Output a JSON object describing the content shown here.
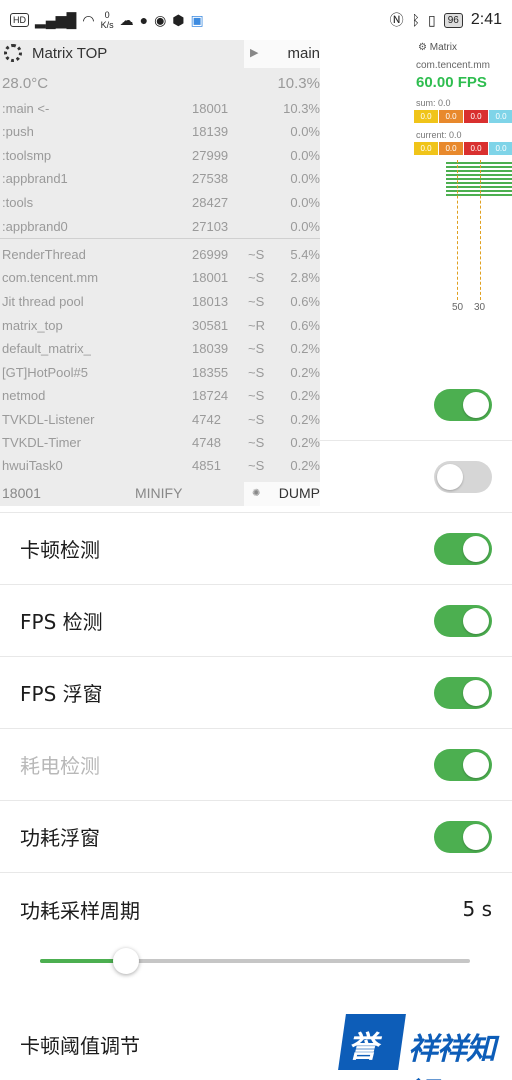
{
  "status_bar": {
    "left_badges": [
      "HD",
      "46",
      "5G"
    ],
    "net_speed_value": "0",
    "net_speed_unit": "K/s",
    "battery": "96",
    "time": "2:41"
  },
  "matrix_panel": {
    "title": "Matrix TOP",
    "tab_label": "main",
    "temperature": "28.0°C",
    "total_cpu": "10.3%",
    "processes": [
      {
        "name": ":main <-",
        "pid": "18001",
        "cpu": "10.3%"
      },
      {
        "name": ":push",
        "pid": "18139",
        "cpu": "0.0%"
      },
      {
        "name": ":toolsmp",
        "pid": "27999",
        "cpu": "0.0%"
      },
      {
        "name": ":appbrand1",
        "pid": "27538",
        "cpu": "0.0%"
      },
      {
        "name": ":tools",
        "pid": "28427",
        "cpu": "0.0%"
      },
      {
        "name": ":appbrand0",
        "pid": "27103",
        "cpu": "0.0%"
      }
    ],
    "threads": [
      {
        "name": "RenderThread",
        "tid": "26999",
        "state": "~S",
        "cpu": "5.4%"
      },
      {
        "name": "com.tencent.mm",
        "tid": "18001",
        "state": "~S",
        "cpu": "2.8%"
      },
      {
        "name": "Jit thread pool",
        "tid": "18013",
        "state": "~S",
        "cpu": "0.6%"
      },
      {
        "name": "matrix_top",
        "tid": "30581",
        "state": "~R",
        "cpu": "0.6%"
      },
      {
        "name": "default_matrix_",
        "tid": "18039",
        "state": "~S",
        "cpu": "0.2%"
      },
      {
        "name": "[GT]HotPool#5",
        "tid": "18355",
        "state": "~S",
        "cpu": "0.2%"
      },
      {
        "name": "netmod",
        "tid": "18724",
        "state": "~S",
        "cpu": "0.2%"
      },
      {
        "name": "TVKDL-Listener",
        "tid": "4742",
        "state": "~S",
        "cpu": "0.2%"
      },
      {
        "name": "TVKDL-Timer",
        "tid": "4748",
        "state": "~S",
        "cpu": "0.2%"
      },
      {
        "name": "hwuiTask0",
        "tid": "4851",
        "state": "~S",
        "cpu": "0.2%"
      }
    ],
    "footer_pid": "18001",
    "minify_label": "MINIFY",
    "dump_label": "DUMP"
  },
  "fps_panel": {
    "title": "Matrix",
    "package": "com.tencent.mm",
    "fps": "60.00 FPS",
    "sum_label": "sum: 0.0",
    "sum_cells": [
      "0.0",
      "0.0",
      "0.0",
      "0.0"
    ],
    "current_label": "current: 0.0",
    "current_cells": [
      "0.0",
      "0.0",
      "0.0",
      "0.0"
    ],
    "cell_colors": [
      "#f0c419",
      "#e8892c",
      "#d9302f",
      "#7fd4e8"
    ],
    "axis_labels": [
      "50",
      "30"
    ]
  },
  "settings": {
    "rows": [
      {
        "label": "卡顿检测",
        "state": "on"
      },
      {
        "label": "FPS 检测",
        "state": "on"
      },
      {
        "label": "FPS 浮窗",
        "state": "on"
      },
      {
        "label": "耗电检测",
        "state": "on",
        "disabled": true
      },
      {
        "label": "功耗浮窗",
        "state": "on"
      }
    ],
    "hidden_top_toggles": [
      "on",
      "off"
    ],
    "sample_period_label": "功耗采样周期",
    "sample_period_value": "5 s",
    "sample_period_fraction": 0.2,
    "lag_threshold_label": "卡顿阈值调节"
  },
  "watermark": {
    "char1": "誉",
    "text": "祥祥知识"
  },
  "colors": {
    "accent_green": "#4caf50",
    "fps_green": "#2ebd4f",
    "toggle_off": "#d6d6d6"
  }
}
